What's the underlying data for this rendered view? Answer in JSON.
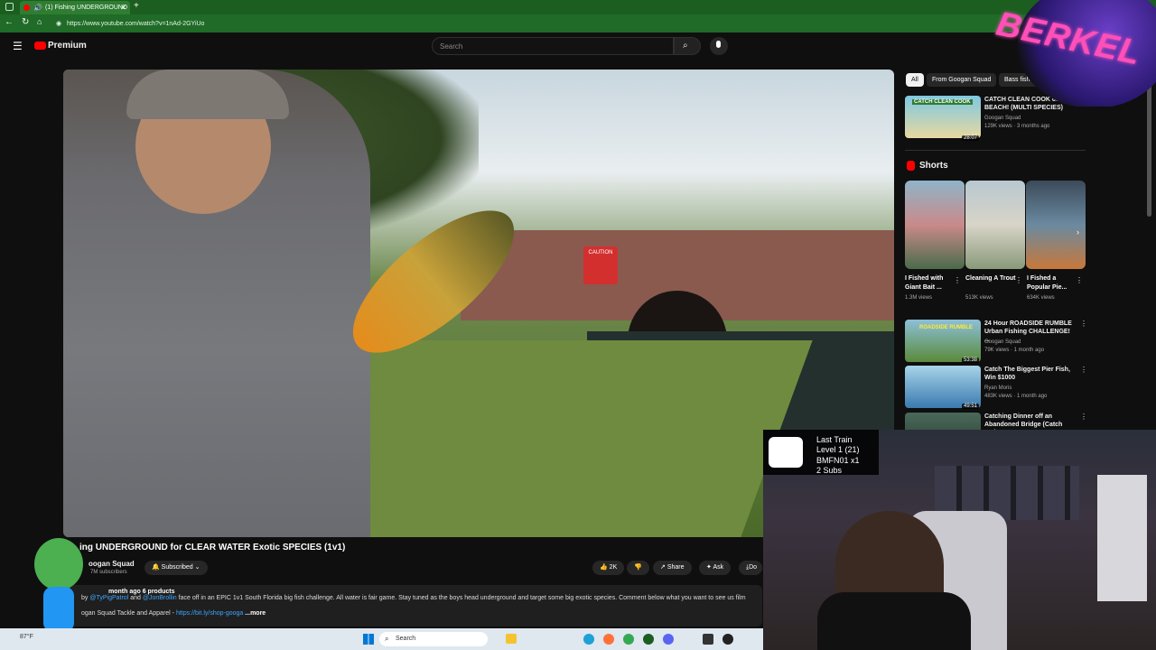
{
  "browser": {
    "tab_title": "(1) Fishing UNDERGROUND",
    "url": "https://www.youtube.com/watch?v=1nAd-2GYiUo"
  },
  "header": {
    "logo_text": "Premium",
    "search_placeholder": "Search"
  },
  "video": {
    "title": "ing UNDERGROUND for CLEAR WATER Exotic SPECIES (1v1)",
    "channel_name": "oogan Squad",
    "subscribers": "7M subscribers",
    "subscribe_label": "Subscribed",
    "likes": "2K",
    "share_label": "Share",
    "ask_label": "Ask",
    "download_label": "Do",
    "sign_text": "CAUTION"
  },
  "description": {
    "meta": "month ago  6 products",
    "line1_prefix": "by",
    "mention1": "@TyPigPatrol",
    "and": "and",
    "mention2": "@JonBrollin",
    "line1_text": "face off in an EPIC 1v1 South Florida big fish challenge. All water is fair game.  Stay tuned as the boys head underground and target some big exotic species.  Comment below what you want to see us film",
    "line2_prefix": "ogan Squad Tackle and Apparel -",
    "link": "https://bit.ly/shop-googa",
    "more": "...more"
  },
  "filters": [
    "All",
    "From Googan Squad",
    "Bass fishing"
  ],
  "recommended_top": {
    "title": "CATCH CLEAN COOK on the BEACH! (MULTI SPECIES)",
    "channel": "Googan Squad",
    "meta": "129K views · 3 months ago",
    "duration": "28:07",
    "thumb_text": "CATCH CLEAN COOK"
  },
  "shorts": {
    "heading": "Shorts",
    "items": [
      {
        "title": "I Fished with Giant Bait ...",
        "views": "1.3M views"
      },
      {
        "title": "Cleaning A Trout",
        "views": "513K views"
      },
      {
        "title": "I Fished a Popular Pie...",
        "views": "634K views"
      }
    ]
  },
  "recommended": [
    {
      "title": "24 Hour ROADSIDE RUMBLE Urban Fishing CHALLENGE! ...",
      "channel": "Googan Squad",
      "meta": "79K views · 1 month ago",
      "duration": "53:38",
      "thumb_text": "ROADSIDE RUMBLE"
    },
    {
      "title": "Catch The Biggest Pier Fish, Win $1000",
      "channel": "Ryan Moris",
      "meta": "483K views · 1 month ago",
      "duration": "49:51",
      "thumb_text": ""
    },
    {
      "title": "Catching Dinner off an Abandoned Bridge (Catch and ...",
      "channel": "",
      "meta": "",
      "duration": "",
      "thumb_text": ""
    }
  ],
  "overlay": {
    "train_name": "Last Train",
    "level": "Level 1  (21)",
    "code": "BMFN01 x1",
    "subs": "2 Subs",
    "berkel_text": "BERKEL"
  },
  "taskbar": {
    "search_label": "Search",
    "weather": "87°F"
  },
  "colors": {
    "browser_green": "#1b5e20",
    "youtube_red": "#ff0000",
    "berkel_pink": "#ff4fb8"
  }
}
